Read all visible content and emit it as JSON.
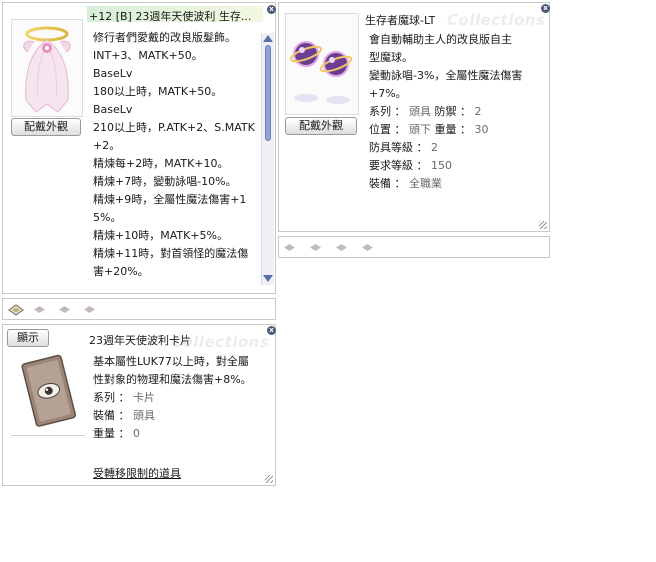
{
  "windows": {
    "item1": {
      "title": "+12 [B] 23週年天使波利 生存...",
      "button": "配戴外觀",
      "lines": [
        "修行者們愛戴的改良版髮飾。",
        "INT+3、MATK+50。",
        "BaseLv",
        "180以上時，MATK+50。",
        "BaseLv",
        "210以上時，P.ATK+2、S.MATK",
        "+2。",
        "精煉每+2時，MATK+10。",
        "精煉+7時，變動詠唱-10%。",
        "精煉+9時，全屬性魔法傷害+1",
        "5%。",
        "精煉+10時，MATK+5%。",
        "精煉+11時，對首領怪的魔法傷",
        "害+20%。"
      ]
    },
    "item2": {
      "title": "生存者魔球-LT",
      "button": "配戴外觀",
      "lines": [
        "會自動輔助主人的改良版自主",
        "型魔球。",
        "變動詠唱-3%，全屬性魔法傷害",
        "+7%。"
      ],
      "props": [
        {
          "label": "系列 ：",
          "value": "頭具",
          "label2": "防禦 ：",
          "value2": "2"
        },
        {
          "label": "位置 ：",
          "value": "頭下",
          "label2": "重量 ：",
          "value2": "30"
        },
        {
          "label": "防具等級 ：",
          "value": "2"
        },
        {
          "label": "要求等級 ：",
          "value": "150"
        },
        {
          "label": "裝備 ：",
          "value": "全職業"
        }
      ]
    },
    "card": {
      "title": "23週年天使波利卡片",
      "button": "顯示",
      "lines": [
        "基本屬性LUK77以上時，對全屬",
        "性對象的物理和魔法傷害+8%。"
      ],
      "props": [
        {
          "label": "系列 ：",
          "value": "卡片"
        },
        {
          "label": "裝備 ：",
          "value": "頭具"
        },
        {
          "label": "重量 ：",
          "value": "0"
        }
      ],
      "link": "受轉移限制的道具"
    }
  },
  "watermark": "Collections",
  "close_glyph": "x",
  "colors": {
    "accent": "#4a5a7a",
    "slot": "#c4b7bd",
    "header_bar": "#b6e0c8"
  }
}
